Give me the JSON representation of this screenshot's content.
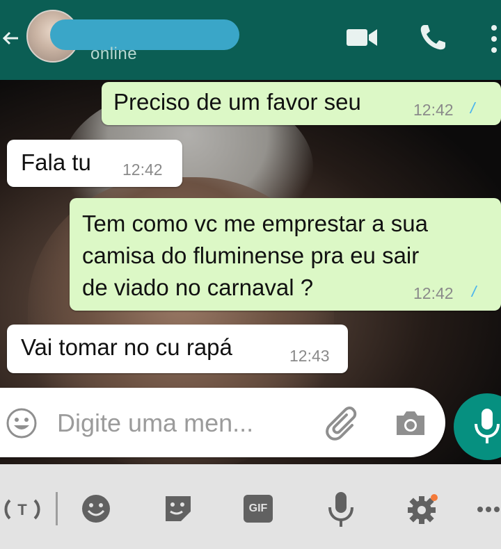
{
  "header": {
    "status": "online"
  },
  "messages": [
    {
      "text": "Preciso de um favor seu",
      "time": "12:42",
      "ticks": "//"
    },
    {
      "text": "Fala tu",
      "time": "12:42"
    },
    {
      "lines": [
        "Tem como vc me emprestar a sua",
        "camisa do fluminense pra eu sair",
        "de viado no carnaval ?"
      ],
      "time": "12:42",
      "ticks": "//"
    },
    {
      "text": "Vai tomar no cu rapá",
      "time": "12:43"
    }
  ],
  "input": {
    "placeholder": "Digite uma men..."
  },
  "keyboard": {
    "gif_label": "GIF"
  },
  "icons": {
    "back": "arrow-left-icon",
    "video": "video-camera-icon",
    "call": "phone-icon",
    "menu": "more-vertical-icon",
    "emoji": "emoji-icon",
    "attach": "paperclip-icon",
    "camera": "camera-icon",
    "mic": "microphone-icon"
  },
  "colors": {
    "header": "#0b5e54",
    "outgoing": "#dcf8c6",
    "incoming": "#ffffff",
    "fab": "#069080",
    "read_ticks": "#4fb6ec"
  }
}
